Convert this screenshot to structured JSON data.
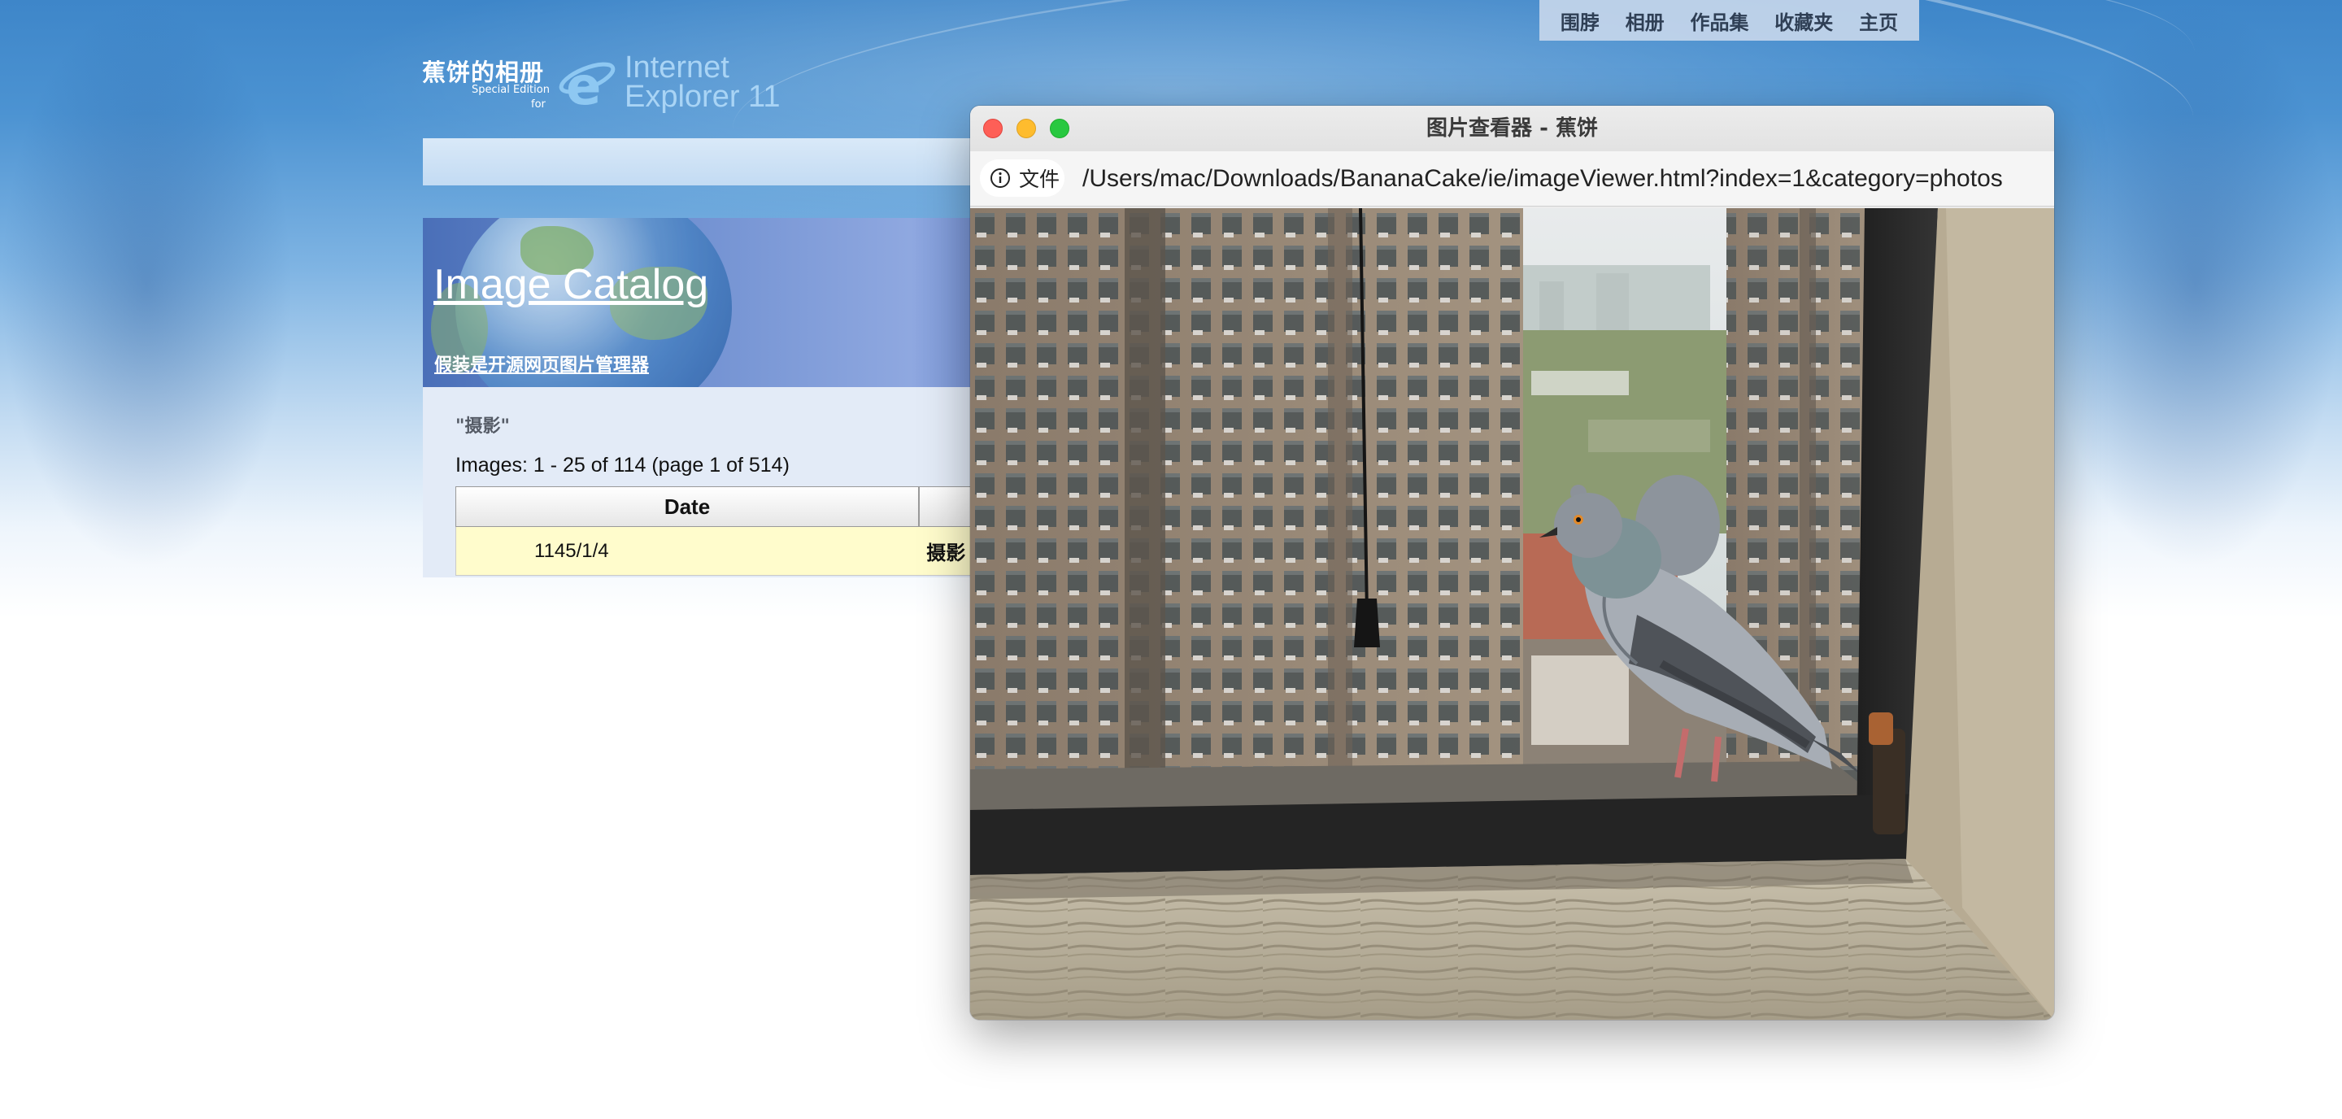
{
  "nav": {
    "items": [
      "围脖",
      "相册",
      "作品集",
      "收藏夹",
      "主页"
    ]
  },
  "logo": {
    "site_title": "蕉饼的相册",
    "special_edition": "Special Edition",
    "for": "for",
    "ie_line1": "Internet",
    "ie_line2": "Explorer 11",
    "ie_icon": "internet-explorer-icon"
  },
  "catalog": {
    "title": "Image Catalog",
    "subtitle": "假装是开源网页图片管理器",
    "quoted_category": "\"摄影\"",
    "images_count": "Images: 1 - 25 of 114 (page 1 of 514)",
    "table": {
      "headers": [
        "Date",
        ""
      ],
      "rows": [
        {
          "date": "1145/1/4",
          "category": "摄影"
        }
      ]
    }
  },
  "viewer": {
    "window_title": "图片查看器 - 蕉饼",
    "chip_icon": "info-icon",
    "chip_label": "文件",
    "url": "/Users/mac/Downloads/BananaCake/ie/imageViewer.html?index=1&category=photos",
    "photo_description_icon": "photo-pigeon-on-window-ledge",
    "colors": {
      "close": "#fe5f57",
      "minimize": "#febc2e",
      "zoom": "#28c840"
    }
  },
  "colors": {
    "sky_top": "#3e86c9",
    "banner": "#6f8fd0",
    "row_highlight": "#fffccc"
  }
}
